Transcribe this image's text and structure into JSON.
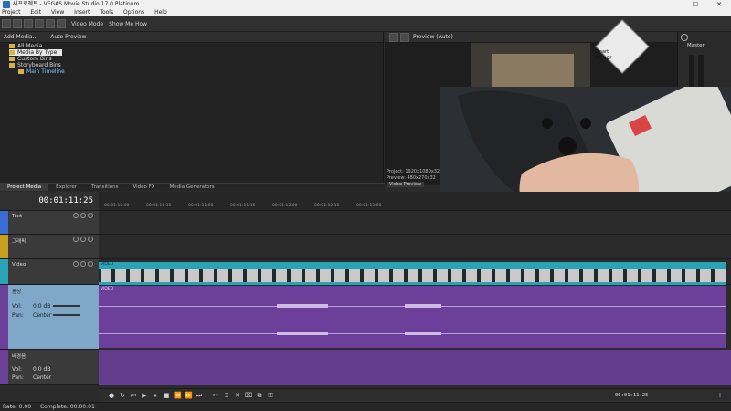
{
  "window": {
    "title": "새프로젝트 - VEGAS Movie Studio 17.0 Platinum",
    "controls": [
      "—",
      "☐",
      "✕"
    ]
  },
  "menu": [
    "Project",
    "Edit",
    "View",
    "Insert",
    "Tools",
    "Options",
    "Help"
  ],
  "toolbar": {
    "video_mode_label": "Video Mode",
    "show_me_how_label": "Show Me How"
  },
  "media_panel": {
    "add_media_label": "Add Media...",
    "auto_preview_label": "Auto Preview",
    "tree": [
      {
        "label": "All Media",
        "selected": false
      },
      {
        "label": "Media By Type",
        "selected": true
      },
      {
        "label": "Custom Bins",
        "selected": false
      },
      {
        "label": "Storyboard Bins",
        "selected": false
      },
      {
        "label": "Main Timeline",
        "selected": false
      }
    ]
  },
  "tabs": [
    "Project Media",
    "Explorer",
    "Transitions",
    "Video FX",
    "Media Generators"
  ],
  "preview": {
    "label": "Preview (Auto)",
    "info_project": "Project: 1920x1080x32",
    "info_preview": "Preview: 480x270x32",
    "video_preview_tab": "Video Preview",
    "overlay_words": [
      "Smart",
      "Mover"
    ]
  },
  "right_panel": {
    "title": "Master"
  },
  "timeline": {
    "timecode": "00:01:11:25",
    "ruler_marks": [
      "00:01:10:00",
      "00:01:10:15",
      "00:01:11:00",
      "00:01:11:15",
      "00:01:12:00",
      "00:01:12:15",
      "00:01:13:00"
    ],
    "tracks": [
      {
        "name": "Text",
        "type": "text",
        "color": "#3a6bd6"
      },
      {
        "name": "그래픽",
        "type": "graphic",
        "color": "#c8a020"
      },
      {
        "name": "Video",
        "type": "video",
        "color": "#2aa3b5"
      },
      {
        "name": "음성",
        "type": "audio",
        "color": "#6b3f9a",
        "vol_label": "Vol:",
        "vol_value": "0.0 dB",
        "pan_label": "Pan:",
        "pan_value": "Center"
      },
      {
        "name": "배경음",
        "type": "audio",
        "color": "#6b3f9a",
        "vol_label": "Vol:",
        "vol_value": "0.0 dB",
        "pan_label": "Pan:",
        "pan_value": "Center"
      }
    ],
    "video_clip_label": "VIDEO",
    "audio_clip_label": "VIDEO"
  },
  "transport": {
    "timecode": "00:01:11:25"
  },
  "status": {
    "rate_label": "Rate: 0.00",
    "complete_label": "Complete: 00:00:01"
  },
  "colors": {
    "video_clip": "#2aa3b5",
    "audio_clip": "#6b3f9a",
    "audio_header": "#7fa8c8"
  }
}
